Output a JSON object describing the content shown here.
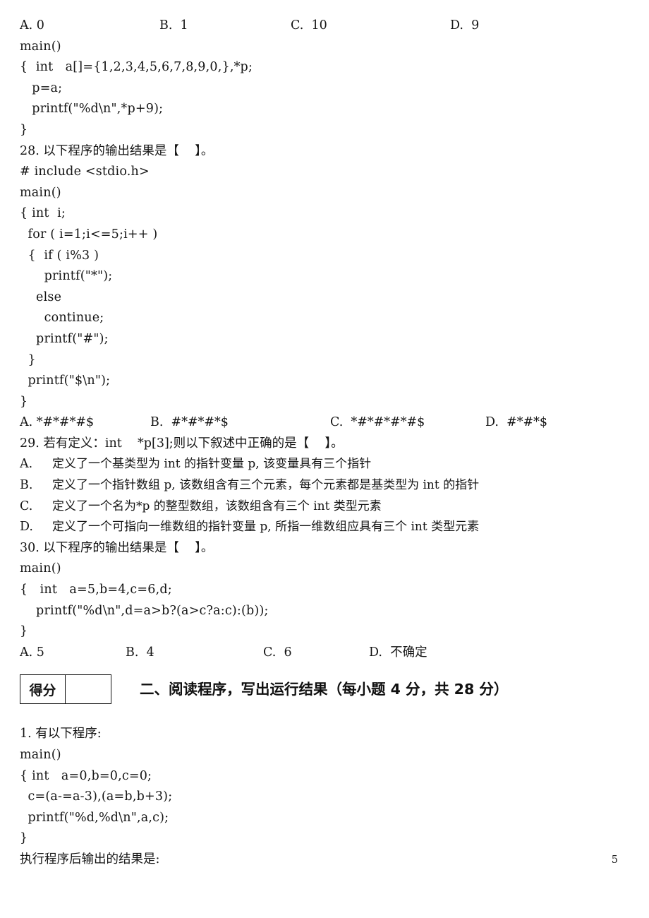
{
  "page": {
    "number": "5"
  },
  "q27_answers": {
    "a": "A. 0",
    "b": "B.  1",
    "c": "C.  10",
    "d": "D.  9"
  },
  "q27_code": [
    "main()",
    "{  int   a[]={1,2,3,4,5,6,7,8,9,0,},*p;",
    "   p=a;",
    "   printf(\"%d\\n\",*p+9);",
    "}"
  ],
  "q28": {
    "stem": "28. 以下程序的输出结果是【    】。",
    "code": [
      "# include <stdio.h>",
      "main()",
      "{ int  i;",
      "  for ( i=1;i<=5;i++ )",
      "  {  if ( i%3 )",
      "      printf(\"*\");",
      "    else",
      "      continue;",
      "    printf(\"#\");",
      "  }",
      "  printf(\"$\\n\");",
      "}"
    ],
    "answers": {
      "a": "A. *#*#*#$",
      "b": "B.  #*#*#*$",
      "c": "C.  *#*#*#*#$",
      "d": "D.  #*#*$"
    }
  },
  "q29": {
    "stem": "29. 若有定义：int    *p[3];则以下叙述中正确的是【    】。",
    "choices": [
      {
        "tag": "A.",
        "text": "定义了一个基类型为 int 的指针变量 p, 该变量具有三个指针"
      },
      {
        "tag": "B.",
        "text": "定义了一个指针数组 p, 该数组含有三个元素，每个元素都是基类型为 int 的指针"
      },
      {
        "tag": "C.",
        "text": "定义了一个名为*p 的整型数组，该数组含有三个 int 类型元素"
      },
      {
        "tag": "D.",
        "text": "定义了一个可指向一维数组的指针变量 p, 所指一维数组应具有三个 int 类型元素"
      }
    ]
  },
  "q30": {
    "stem": "30. 以下程序的输出结果是【    】。",
    "code": [
      "main()",
      "{   int   a=5,b=4,c=6,d;",
      "    printf(\"%d\\n\",d=a>b?(a>c?a:c):(b));",
      "}"
    ],
    "answers": {
      "a": "A. 5",
      "b": "B.  4",
      "c": "C.  6",
      "d": "D.  不确定"
    }
  },
  "section2": {
    "score_label": "得分",
    "score_value": "",
    "title": "二、阅读程序，写出运行结果（每小题 4 分，共 28 分）"
  },
  "reading1": {
    "stem": "1. 有以下程序:",
    "code": [
      "main()",
      "{ int   a=0,b=0,c=0;",
      "  c=(a-=a-3),(a=b,b+3);",
      "  printf(\"%d,%d\\n\",a,c);",
      "}"
    ],
    "prompt": "执行程序后输出的结果是:"
  }
}
